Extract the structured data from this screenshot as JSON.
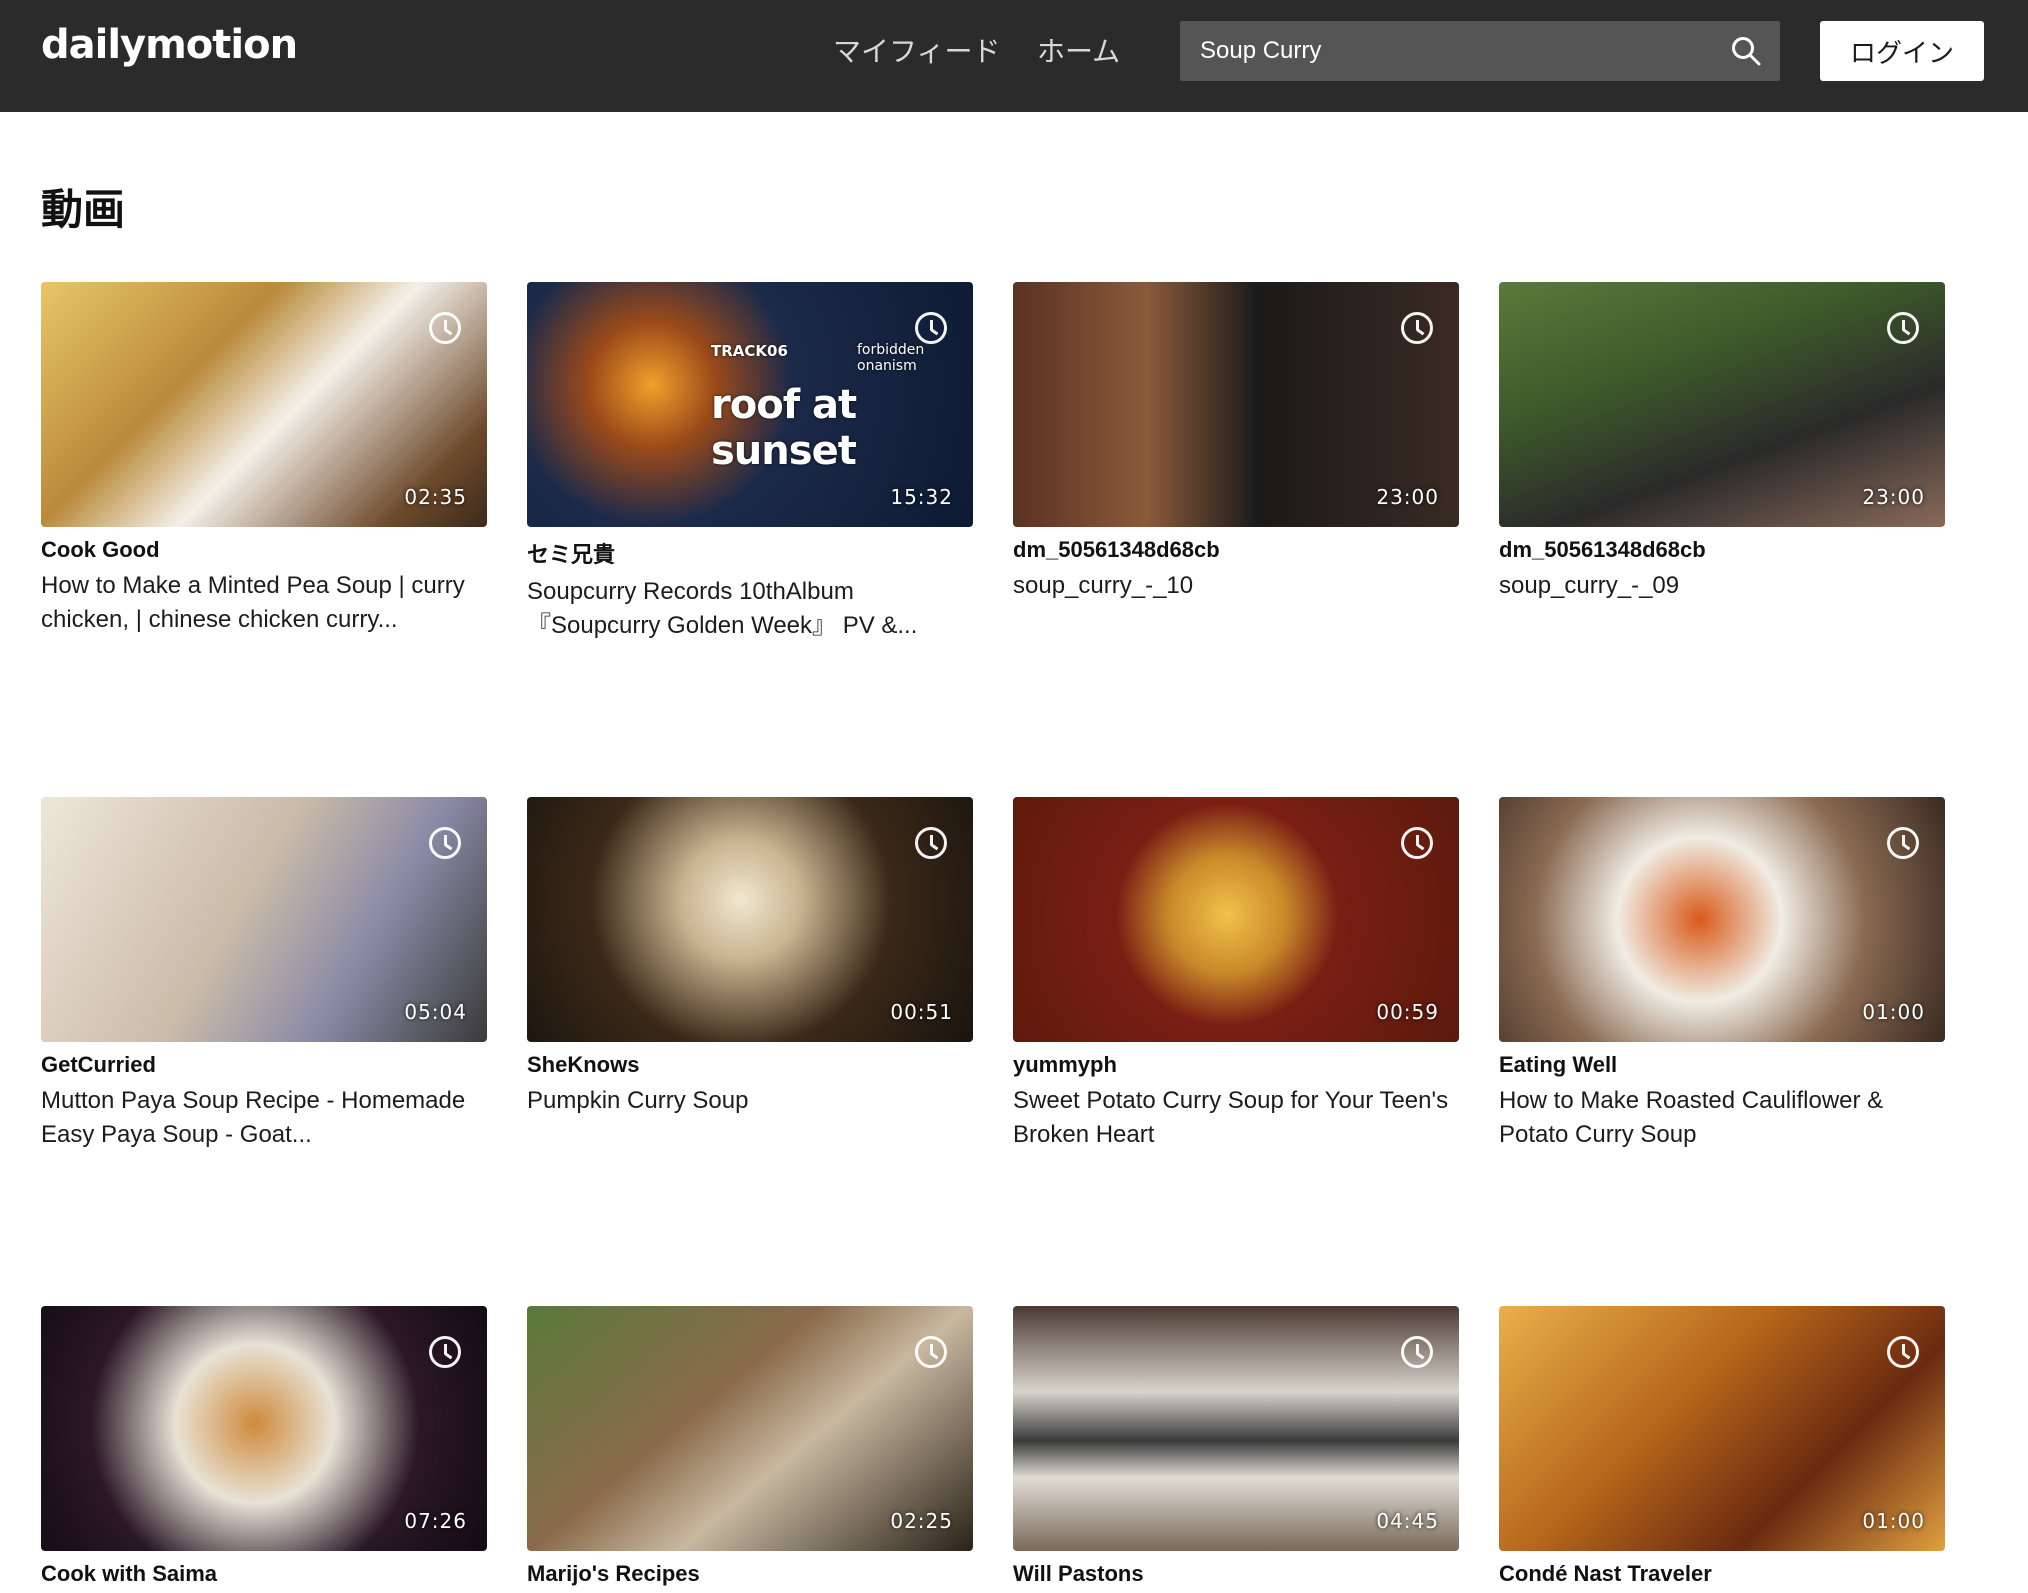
{
  "header": {
    "logo": "dailymotion",
    "nav": {
      "my_feed": "マイフィード",
      "home": "ホーム"
    },
    "search": {
      "value": "Soup Curry"
    },
    "login_label": "ログイン"
  },
  "section": {
    "title": "動画"
  },
  "videos": [
    {
      "channel": "Cook Good",
      "title": "How to Make a Minted Pea Soup | curry chicken, | chinese chicken curry...",
      "duration": "02:35"
    },
    {
      "channel": "セミ兄貴",
      "title": "Soupcurry Records 10thAlbum 『Soupcurry Golden Week』 PV &...",
      "duration": "15:32",
      "overlay": {
        "track": "TRACK06",
        "artist": "forbidden onanism",
        "headline": "roof at sunset"
      }
    },
    {
      "channel": "dm_50561348d68cb",
      "title": "soup_curry_-_10",
      "duration": "23:00"
    },
    {
      "channel": "dm_50561348d68cb",
      "title": "soup_curry_-_09",
      "duration": "23:00"
    },
    {
      "channel": "GetCurried",
      "title": "Mutton Paya Soup Recipe - Homemade Easy Paya Soup - Goat...",
      "duration": "05:04"
    },
    {
      "channel": "SheKnows",
      "title": "Pumpkin Curry Soup",
      "duration": "00:51"
    },
    {
      "channel": "yummyph",
      "title": "Sweet Potato Curry Soup for Your Teen's Broken Heart",
      "duration": "00:59"
    },
    {
      "channel": "Eating Well",
      "title": "How to Make Roasted Cauliflower & Potato Curry Soup",
      "duration": "01:00"
    },
    {
      "channel": "Cook with Saima",
      "title": "",
      "duration": "07:26"
    },
    {
      "channel": "Marijo's Recipes",
      "title": "",
      "duration": "02:25"
    },
    {
      "channel": "Will Pastons",
      "title": "",
      "duration": "04:45"
    },
    {
      "channel": "Condé Nast Traveler",
      "title": "",
      "duration": "01:00"
    }
  ],
  "colors": {
    "topbar": "#2b2b2b",
    "search_bg": "#555555",
    "background": "#ffffff",
    "text": "#111111"
  }
}
